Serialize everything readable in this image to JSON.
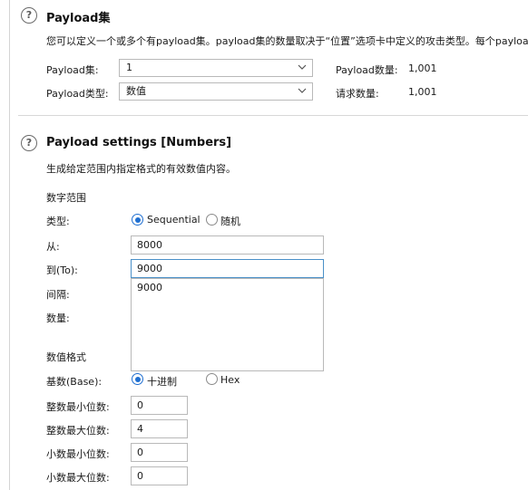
{
  "payload_sets": {
    "title": "Payload集",
    "description": "您可以定义一个或多个有payload集。payload集的数量取决于“位置”选项卡中定义的攻击类型。每个payload",
    "set_label": "Payload集:",
    "set_value": "1",
    "type_label": "Payload类型:",
    "type_value": "数值",
    "count_label": "Payload数量:",
    "count_value": "1,001",
    "requests_label": "请求数量:",
    "requests_value": "1,001"
  },
  "settings": {
    "title": "Payload settings [Numbers]",
    "description": "生成给定范围内指定格式的有效数值内容。",
    "range_heading": "数字范围",
    "type_label": "类型:",
    "type_options": [
      {
        "label": "Sequential",
        "selected": true
      },
      {
        "label": "随机",
        "selected": false
      }
    ],
    "from_label": "从:",
    "from_value": "8000",
    "to_label": "到(To):",
    "to_value": "9000",
    "to_suggestions": [
      "9000"
    ],
    "step_label": "间隔:",
    "howmany_label": "数量:",
    "format_heading": "数值格式",
    "base_label": "基数(Base):",
    "base_options": [
      {
        "label": "十进制",
        "selected": true
      },
      {
        "label": "Hex",
        "selected": false
      }
    ],
    "min_int_label": "整数最小位数:",
    "min_int_value": "0",
    "max_int_label": "整数最大位数:",
    "max_int_value": "4",
    "min_frac_label": "小数最小位数:",
    "min_frac_value": "0",
    "max_frac_label": "小数最大位数:",
    "max_frac_value": "0"
  },
  "icons": {
    "help": "question-circle-icon",
    "dropdown": "chevron-down-icon"
  },
  "colors": {
    "accent": "#1f6fd1",
    "focus_border": "#4a90c8"
  }
}
